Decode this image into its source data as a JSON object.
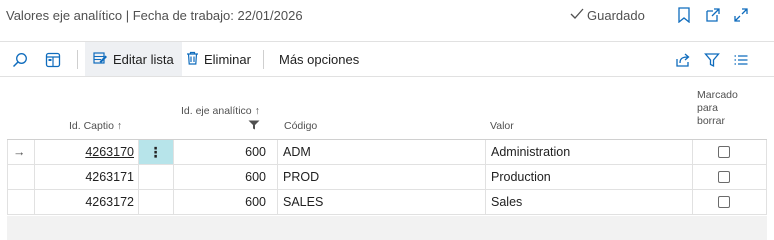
{
  "header": {
    "title": "Valores eje analítico | Fecha de trabajo: 22/01/2026",
    "saved_label": "Guardado"
  },
  "actions": {
    "edit_list": "Editar lista",
    "delete": "Eliminar",
    "more_options": "Más opciones"
  },
  "columns": {
    "id_caption": "Id. Captio",
    "id_caption_arrow": "↑",
    "id_dimension": "Id. eje analítico",
    "id_dimension_arrow": "↑",
    "code": "Código",
    "value": "Valor",
    "marked_1": "Marcado",
    "marked_2": "para",
    "marked_3": "borrar"
  },
  "row_actions_glyph": "⋮",
  "current_row_glyph": "→",
  "rows": [
    {
      "id": "4263170",
      "dimension_id": "600",
      "code": "ADM",
      "value": "Administration",
      "marked": false
    },
    {
      "id": "4263171",
      "dimension_id": "600",
      "code": "PROD",
      "value": "Production",
      "marked": false
    },
    {
      "id": "4263172",
      "dimension_id": "600",
      "code": "SALES",
      "value": "Sales",
      "marked": false
    }
  ],
  "icons": {
    "saved": "checkmark-icon",
    "bookmark": "bookmark-icon",
    "open_new": "open-in-new-window-icon",
    "expand": "expand-icon",
    "search": "search-icon",
    "view": "page-view-icon",
    "edit_list": "edit-list-icon",
    "delete": "trash-icon",
    "share": "share-icon",
    "filter": "filter-icon",
    "list": "list-icon"
  },
  "colors": {
    "accent": "#0f6cbd",
    "selected_cell": "#b7e4ea",
    "active_button": "#eef0f3"
  }
}
